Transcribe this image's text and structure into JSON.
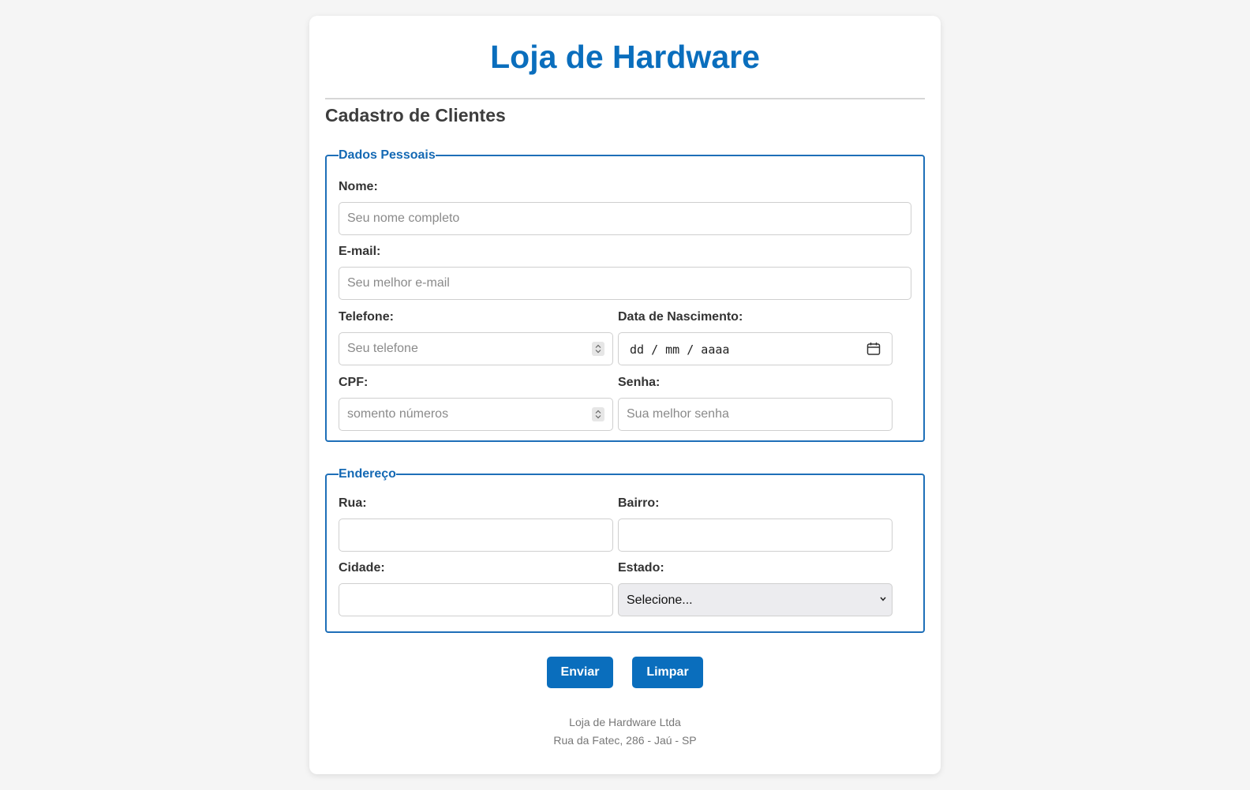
{
  "header": {
    "site_title": "Loja de Hardware",
    "section_title": "Cadastro de Clientes"
  },
  "personal": {
    "legend": "Dados Pessoais",
    "nome": {
      "label": "Nome:",
      "placeholder": "Seu nome completo"
    },
    "email": {
      "label": "E-mail:",
      "placeholder": "Seu melhor e-mail"
    },
    "telefone": {
      "label": "Telefone:",
      "placeholder": "Seu telefone"
    },
    "nascimento": {
      "label": "Data de Nascimento:",
      "value": "dd / mm / aaaa"
    },
    "cpf": {
      "label": "CPF:",
      "placeholder": "somento números"
    },
    "senha": {
      "label": "Senha:",
      "placeholder": "Sua melhor senha"
    }
  },
  "address": {
    "legend": "Endereço",
    "rua": {
      "label": "Rua:",
      "value": ""
    },
    "bairro": {
      "label": "Bairro:",
      "value": ""
    },
    "cidade": {
      "label": "Cidade:",
      "value": ""
    },
    "estado": {
      "label": "Estado:",
      "selected": "Selecione..."
    }
  },
  "actions": {
    "send_label": "Enviar",
    "clear_label": "Limpar"
  },
  "footer": {
    "line1": "Loja de Hardware Ltda",
    "line2": "Rua da Fatec, 286 - Jaú - SP"
  },
  "colors": {
    "accent": "#0a6ebd",
    "fieldset_border": "#1e6fb8",
    "page_background": "#f5f5f5"
  },
  "icons": {
    "date_picker": "calendar-icon",
    "select": "chevron-down-icon",
    "number_spinner": "spinner-icon"
  }
}
